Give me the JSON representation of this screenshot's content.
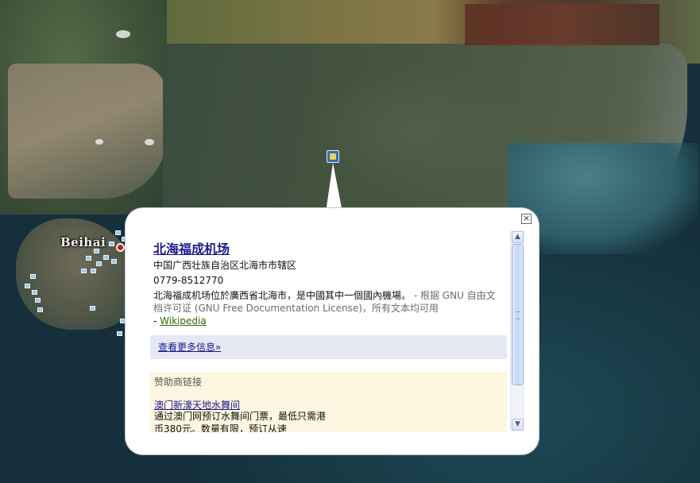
{
  "map": {
    "city_label": "Beihai"
  },
  "balloon": {
    "title": "北海福成机场",
    "address": "中国广西壮族自治区北海市市辖区",
    "phone": "0779-8512770",
    "description": "北海福成机场位於廣西省北海市，是中國其中一個國內機場。",
    "license": " - 根据 GNU 自由文档许可证 (GNU Free Documentation License)，所有文本均可用",
    "source_prefix": "- ",
    "source_link": "Wikipedia",
    "more_info": "查看更多信息»",
    "sponsor_header": "赞助商链接",
    "ad_title": "澳门新濠天地水舞间",
    "ad_text": "通过澳门网预订水舞间门票，最低只需港币380元。数量有限，预订从速"
  },
  "scrollbar": {
    "up_icon": "arrow-up-icon",
    "down_icon": "arrow-down-icon"
  },
  "colors": {
    "link": "#1b1b8d",
    "wiki_link": "#2b6b00",
    "more_box": "#e6e9f4",
    "sponsor_box": "#fdf6e0",
    "city_dot": "#c21e22"
  }
}
